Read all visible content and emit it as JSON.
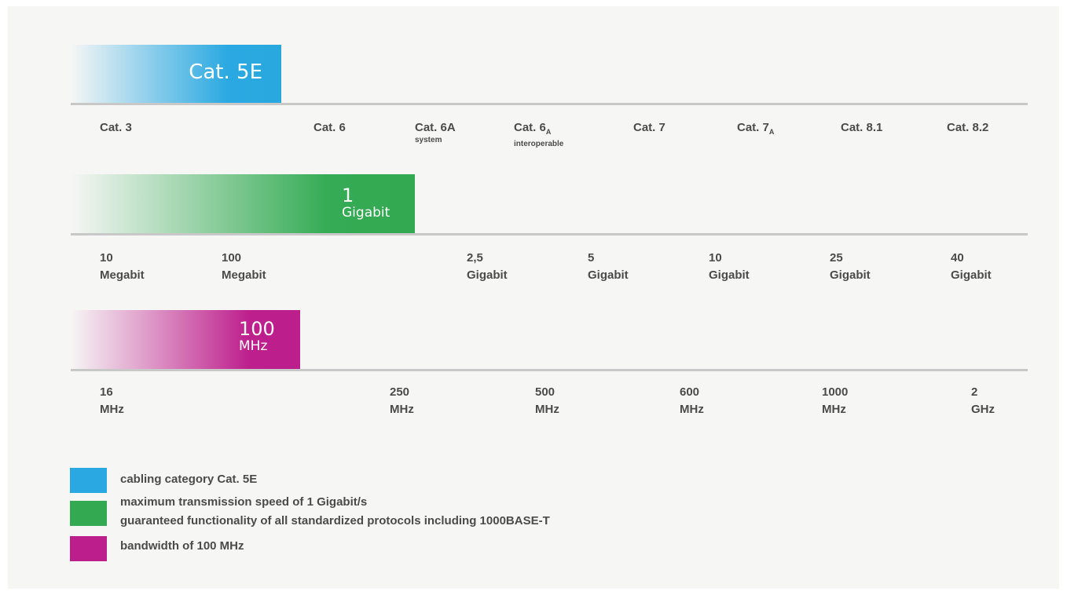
{
  "colors": {
    "blue": "#2aa8e1",
    "green": "#33a952",
    "magenta": "#bc1e8b",
    "axis": "#c8c8c8",
    "panel": "#f6f6f5"
  },
  "bars": {
    "category": {
      "label": "Cat. 5E"
    },
    "speed": {
      "value": "1",
      "unit": "Gigabit"
    },
    "bandwidth": {
      "value": "100",
      "unit": "MHz"
    }
  },
  "category_ticks": [
    {
      "label": "Cat. 3"
    },
    {
      "label": "Cat. 6"
    },
    {
      "label": "Cat. 6A",
      "note": "system"
    },
    {
      "label": "Cat. 6",
      "sub": "A",
      "note": "interoperable"
    },
    {
      "label": "Cat. 7"
    },
    {
      "label": "Cat. 7",
      "sub": "A"
    },
    {
      "label": "Cat. 8.1"
    },
    {
      "label": "Cat. 8.2"
    }
  ],
  "speed_ticks": [
    {
      "value": "10",
      "unit": "Megabit"
    },
    {
      "value": "100",
      "unit": "Megabit"
    },
    {
      "value": "2,5",
      "unit": "Gigabit"
    },
    {
      "value": "5",
      "unit": "Gigabit"
    },
    {
      "value": "10",
      "unit": "Gigabit"
    },
    {
      "value": "25",
      "unit": "Gigabit"
    },
    {
      "value": "40",
      "unit": "Gigabit"
    }
  ],
  "bandwidth_ticks": [
    {
      "value": "16",
      "unit": "MHz"
    },
    {
      "value": "250",
      "unit": "MHz"
    },
    {
      "value": "500",
      "unit": "MHz"
    },
    {
      "value": "600",
      "unit": "MHz"
    },
    {
      "value": "1000",
      "unit": "MHz"
    },
    {
      "value": "2",
      "unit": "GHz"
    }
  ],
  "legend": [
    {
      "color": "#2aa8e1",
      "lines": [
        "cabling category Cat. 5E"
      ]
    },
    {
      "color": "#33a952",
      "lines": [
        "maximum transmission speed of 1 Gigabit/s",
        "guaranteed functionality of all standardized protocols including 1000BASE-T"
      ]
    },
    {
      "color": "#bc1e8b",
      "lines": [
        "bandwidth of 100 MHz"
      ]
    }
  ]
}
